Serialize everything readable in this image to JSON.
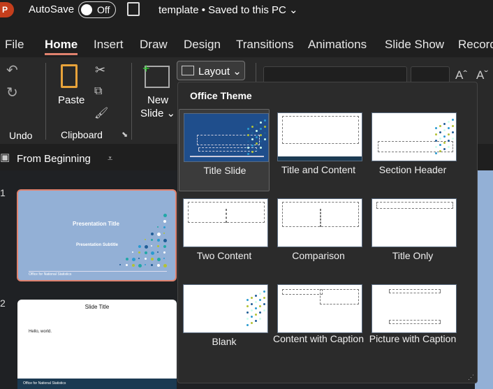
{
  "titlebar": {
    "app_icon": "P",
    "autosave_label": "AutoSave",
    "autosave_state": "Off",
    "doc_title": "template • Saved to this PC"
  },
  "tabs": [
    "File",
    "Home",
    "Insert",
    "Draw",
    "Design",
    "Transitions",
    "Animations",
    "Slide Show",
    "Record"
  ],
  "active_tab": "Home",
  "ribbon": {
    "undo_group": "Undo",
    "paste": "Paste",
    "clipboard_group": "Clipboard",
    "new_slide_1": "New",
    "new_slide_2": "Slide",
    "layout": "Layout"
  },
  "toolbar": {
    "from_beginning": "From Beginning"
  },
  "slides": [
    {
      "number": "1",
      "title": "Presentation Title",
      "subtitle": "Presentation Subtitle",
      "footer": "Office for National Statistics",
      "background": "#93b0d6"
    },
    {
      "number": "2",
      "title": "Slide Title",
      "body": "Hello, world.",
      "footer": "Office for National Statistics"
    }
  ],
  "layout_menu": {
    "heading": "Office Theme",
    "selected": "Title Slide",
    "items": [
      "Title Slide",
      "Title and Content",
      "Section Header",
      "Two Content",
      "Comparison",
      "Title Only",
      "Blank",
      "Content with Caption",
      "Picture with Caption"
    ]
  },
  "colors": {
    "accent": "#e0826e",
    "ppt": "#c43e1c",
    "thumb_blue": "#1f4e8c"
  }
}
